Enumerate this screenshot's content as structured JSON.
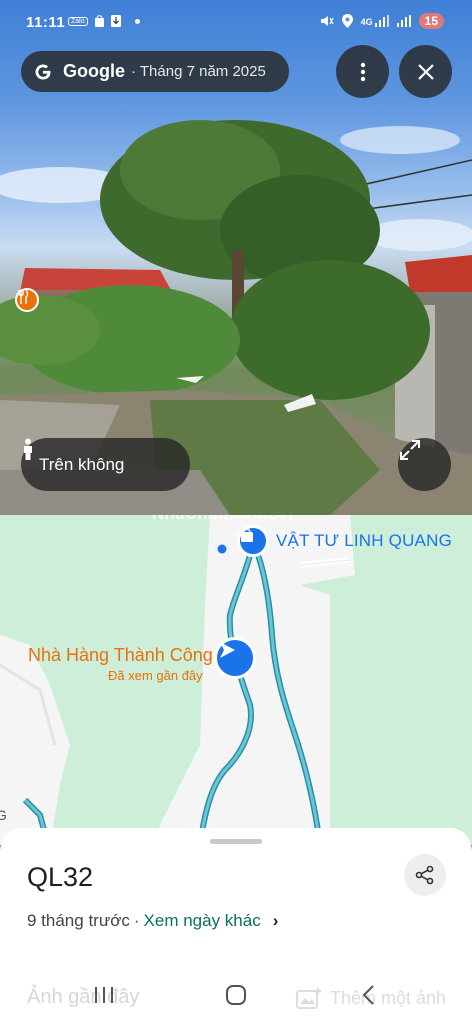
{
  "status_bar": {
    "time": "11:11",
    "left_icons": [
      "zalo-icon",
      "bag-icon",
      "download-icon",
      "dot-icon"
    ],
    "right_icons": [
      "mute-icon",
      "location-icon",
      "4g-signal-icon",
      "signal-icon"
    ],
    "network": "4G",
    "battery": "15"
  },
  "header": {
    "brand": "Google",
    "date": "· Tháng 7 năm 2025",
    "more_icon": "more-vert-icon",
    "close_icon": "close-icon"
  },
  "photo_controls": {
    "above_label": "Trên không",
    "expand_icon": "expand-icon",
    "poi_icon": "restaurant-icon"
  },
  "map": {
    "watermark": "NhaChinhChu247",
    "store_label": "VẬT TƯ LINH QUANG",
    "restaurant_label": "Nhà Hàng Thành Công",
    "restaurant_sub": "Đã xem gần đây",
    "edge_letter": "G",
    "colors": {
      "background": "#cdeed8",
      "road": "#ffffff",
      "street_view_line": "#4fb3c8",
      "accent_blue": "#1a73e8",
      "accent_orange": "#e8710a"
    }
  },
  "sheet": {
    "road_name": "QL32",
    "time_ago": "9 tháng trước",
    "separator": "·",
    "other_dates_link": "Xem ngày khác",
    "faded_left": "Ảnh gần đây",
    "faded_right": "Thêm một ảnh",
    "share_icon": "share-icon"
  },
  "navbar": {
    "recent_icon": "recent-apps-icon",
    "home_icon": "home-icon",
    "back_icon": "back-icon"
  }
}
